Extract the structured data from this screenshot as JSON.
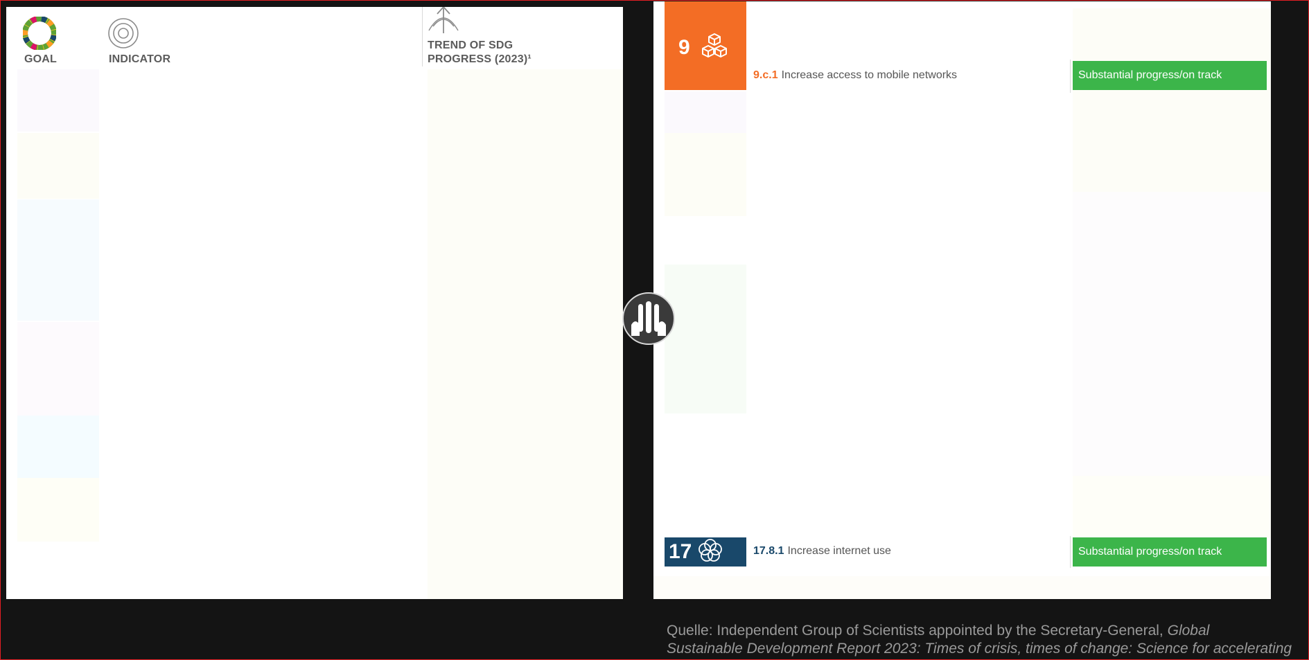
{
  "header": {
    "goal_label": "GOAL",
    "indicator_label": "INDICATOR",
    "trend_label_line1": "TREND OF SDG",
    "trend_label_line2": "PROGRESS (2023)¹"
  },
  "rows": [
    {
      "goal_number": "9",
      "goal_color": "#f36d25",
      "goal_icon": "cubes-icon",
      "indicator_code": "9.c.1",
      "indicator_text": "Increase access to mobile networks",
      "status": "Substantial progress/on track"
    },
    {
      "goal_number": "17",
      "goal_color": "#19486a",
      "goal_icon": "flower-rings-icon",
      "indicator_code": "17.8.1",
      "indicator_text": "Increase internet use",
      "status": "Substantial progress/on track"
    }
  ],
  "colors": {
    "status_green": "#3cb54a",
    "goal9_orange": "#f36d25",
    "goal17_navy": "#19486a"
  },
  "source": {
    "prefix": "Quelle:  Independent Group of Scientists appointed by the Secretary-General, ",
    "title_italic_1": "Global",
    "title_italic_2": "Sustainable Development Report 2023: Times of crisis, times of change: Science for accelerating"
  }
}
